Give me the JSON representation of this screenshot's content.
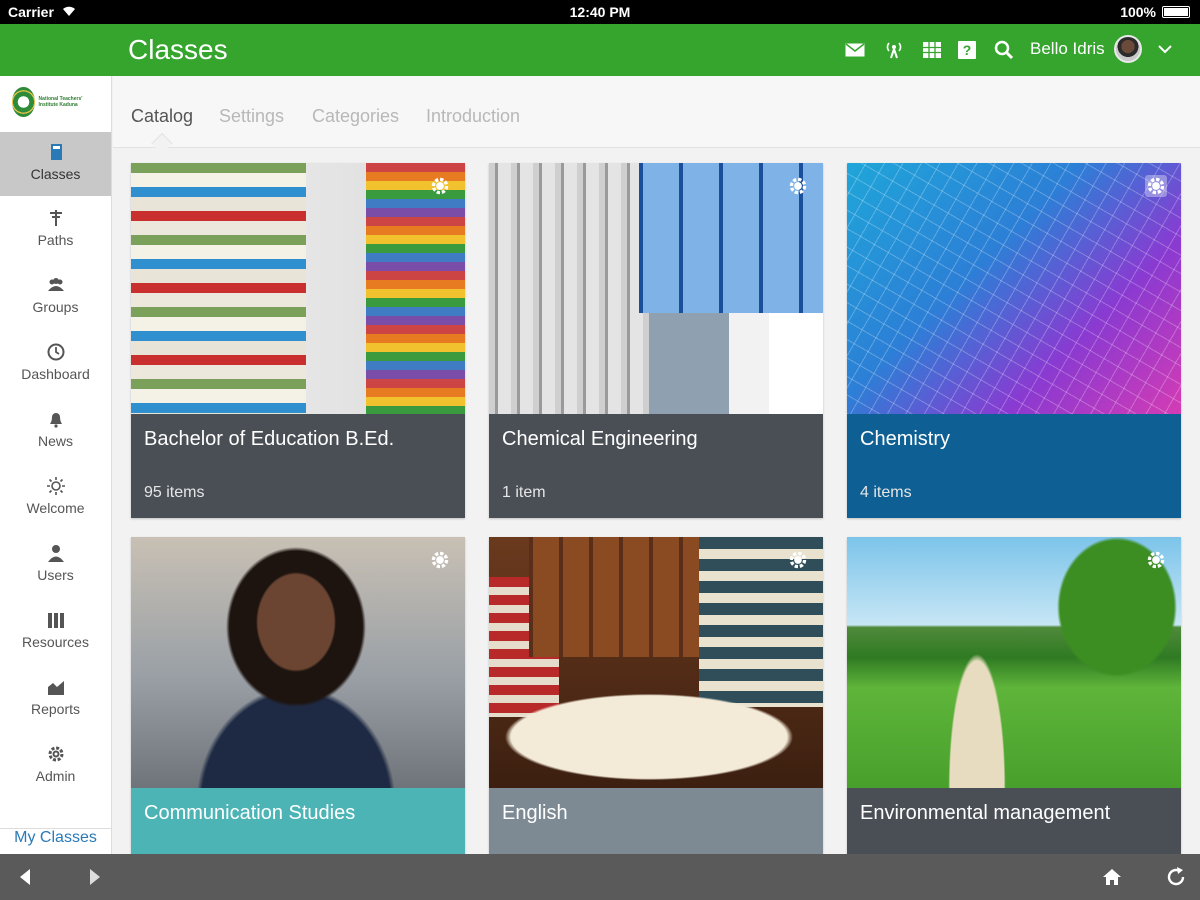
{
  "status_bar": {
    "carrier": "Carrier",
    "time": "12:40 PM",
    "battery": "100%"
  },
  "header": {
    "title": "Classes",
    "user_name": "Bello Idris",
    "icons": [
      "mail-icon",
      "signal-icon",
      "grid-icon",
      "help-icon",
      "search-icon",
      "chevron-down-icon"
    ]
  },
  "brand_color": "#35a52e",
  "sidebar": {
    "logo_text": "National Teachers' Institute Kaduna",
    "items": [
      {
        "label": "Classes",
        "icon": "book-icon",
        "active": true
      },
      {
        "label": "Paths",
        "icon": "signpost-icon"
      },
      {
        "label": "Groups",
        "icon": "group-icon"
      },
      {
        "label": "Dashboard",
        "icon": "clock-icon"
      },
      {
        "label": "News",
        "icon": "bell-icon"
      },
      {
        "label": "Welcome",
        "icon": "sun-icon"
      },
      {
        "label": "Users",
        "icon": "user-icon"
      },
      {
        "label": "Resources",
        "icon": "library-icon"
      },
      {
        "label": "Reports",
        "icon": "chart-icon"
      },
      {
        "label": "Admin",
        "icon": "gear-icon"
      }
    ],
    "footer": "My Classes"
  },
  "tabs": [
    {
      "label": "Catalog",
      "active": true
    },
    {
      "label": "Settings"
    },
    {
      "label": "Categories"
    },
    {
      "label": "Introduction"
    }
  ],
  "classes": [
    {
      "title": "Bachelor of Education B.Ed.",
      "count": "95 items",
      "caption_color": "#4a4f56"
    },
    {
      "title": "Chemical Engineering",
      "count": "1 item",
      "caption_color": "#4a4f56"
    },
    {
      "title": "Chemistry",
      "count": "4 items",
      "caption_color": "#0e5f93"
    },
    {
      "title": "Communication Studies",
      "count": "",
      "caption_color": "#4db4b6"
    },
    {
      "title": "English",
      "count": "",
      "caption_color": "#7d8a93"
    },
    {
      "title": "Environmental management",
      "count": "",
      "caption_color": "#4a4f56"
    }
  ],
  "toolbar": {
    "icons": [
      "back-arrow-icon",
      "forward-arrow-icon",
      "home-icon",
      "refresh-icon"
    ]
  }
}
